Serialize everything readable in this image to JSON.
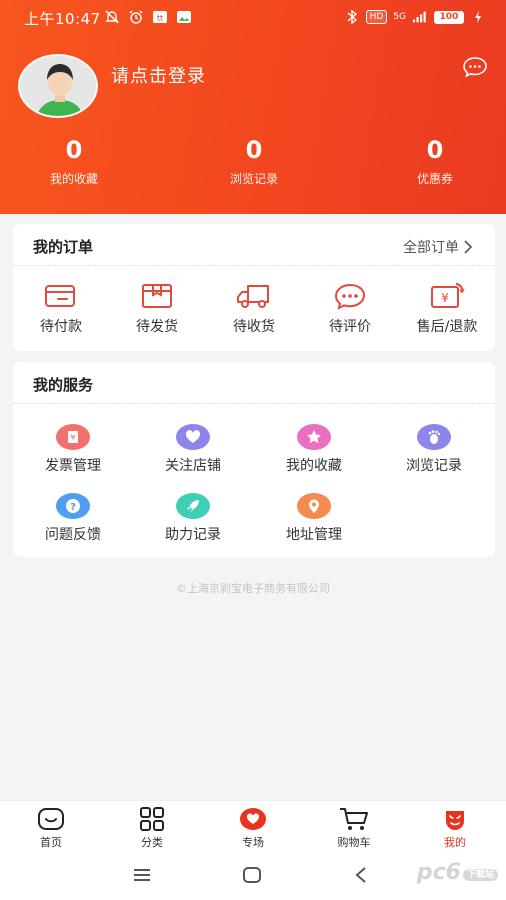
{
  "status_bar": {
    "time": "上午10:47",
    "network": "5G",
    "hd": "HD",
    "battery": "100"
  },
  "profile": {
    "login_prompt": "请点击登录"
  },
  "stats": [
    {
      "value": "0",
      "label": "我的收藏"
    },
    {
      "value": "0",
      "label": "浏览记录"
    },
    {
      "value": "0",
      "label": "优惠券"
    }
  ],
  "orders": {
    "title": "我的订单",
    "all_label": "全部订单",
    "items": [
      {
        "label": "待付款",
        "icon": "wallet-icon"
      },
      {
        "label": "待发货",
        "icon": "package-icon"
      },
      {
        "label": "待收货",
        "icon": "truck-icon"
      },
      {
        "label": "待评价",
        "icon": "chat-bubble-icon"
      },
      {
        "label": "售后/退款",
        "icon": "refund-icon"
      }
    ]
  },
  "services": {
    "title": "我的服务",
    "items": [
      {
        "label": "发票管理",
        "icon": "invoice-icon",
        "color": "#f2716c"
      },
      {
        "label": "关注店铺",
        "icon": "heart-icon",
        "color": "#8f84ea"
      },
      {
        "label": "我的收藏",
        "icon": "star-icon",
        "color": "#ea6fc0"
      },
      {
        "label": "浏览记录",
        "icon": "footprint-icon",
        "color": "#8d86ea"
      },
      {
        "label": "问题反馈",
        "icon": "question-icon",
        "color": "#4f9ef0"
      },
      {
        "label": "助力记录",
        "icon": "rocket-icon",
        "color": "#3ecfb6"
      },
      {
        "label": "地址管理",
        "icon": "location-icon",
        "color": "#f48a4e"
      }
    ]
  },
  "footer": {
    "copyright": "©上海京剥宝电子商务有限公司"
  },
  "tabbar": {
    "items": [
      {
        "label": "首页",
        "icon": "home-icon"
      },
      {
        "label": "分类",
        "icon": "grid-icon"
      },
      {
        "label": "专场",
        "icon": "heart-badge-icon"
      },
      {
        "label": "购物车",
        "icon": "cart-icon"
      },
      {
        "label": "我的",
        "icon": "user-icon",
        "active": true
      }
    ]
  },
  "watermark": {
    "text": "pc6",
    "badge": "下载站"
  },
  "colors": {
    "brand": "#f2461f",
    "active_tab": "#e8331f",
    "icon_red": "#e14a3c"
  }
}
